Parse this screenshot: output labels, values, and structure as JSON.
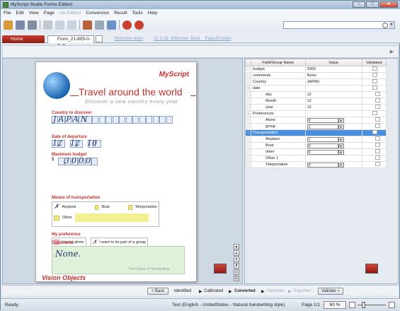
{
  "window": {
    "title": "MyScript Studio Forms Edition",
    "min_label": "–",
    "max_label": "□",
    "close_label": "✕"
  },
  "menu": [
    "File",
    "Edit",
    "View",
    "Page",
    "Ink Edition",
    "Conversion",
    "Result",
    "Tools",
    "Help"
  ],
  "menu_disabled": [
    "Ink Edition"
  ],
  "tabs": {
    "home": "Home",
    "form": "Form_21-805-0-7_0",
    "links": [
      "Welcome.notes",
      "22-2-18_Welcome_Book__Page20.notes"
    ]
  },
  "toolbar_icons": [
    "open-icon",
    "save-icon",
    "print-icon",
    "cut-icon",
    "copy-icon",
    "paste-icon",
    "ink-icon",
    "erase-icon",
    "convert-icon",
    "settings-icon",
    "help-icon"
  ],
  "form": {
    "brand": "MyScript",
    "title": "Travel around the world",
    "subtitle": "Discover a new country every year",
    "country_label": "Country to discover",
    "country_value": "JAPAN",
    "date_label": "Date of departure",
    "date_parts": [
      "12",
      "12",
      "10"
    ],
    "budget_label": "Maximum budget",
    "budget_currency": "$",
    "budget_value": "3000",
    "transport_label": "Means of transportation",
    "transport_options": [
      "Airplane",
      "Boat",
      "Teleportation"
    ],
    "transport_other": "Other",
    "pref_label": "My preference",
    "pref_options": [
      "I travel alone",
      "I want to be part of a group"
    ],
    "comments_label": "Comments",
    "comments_value": "None.",
    "footer_brand": "Vision Objects",
    "footer_tagline": "The Future of Handwriting"
  },
  "table": {
    "headers": [
      "Field/Group Name",
      "Value",
      "Validated"
    ],
    "rows": [
      {
        "name": "budget",
        "value": "3000",
        "indent": 0
      },
      {
        "name": "comments",
        "value": "None.",
        "indent": 0
      },
      {
        "name": "Country",
        "value": "JAPAN",
        "indent": 0
      },
      {
        "name": "date",
        "value": "",
        "indent": 0,
        "group": true
      },
      {
        "name": "day",
        "value": "12",
        "indent": 1
      },
      {
        "name": "Month",
        "value": "12",
        "indent": 1
      },
      {
        "name": "year",
        "value": "10",
        "indent": 1
      },
      {
        "name": "Preferences",
        "value": "",
        "indent": 0,
        "group": true
      },
      {
        "name": "Alone",
        "value": "0",
        "indent": 1,
        "input": true
      },
      {
        "name": "group",
        "value": "1",
        "indent": 1,
        "input": true
      },
      {
        "name": "Transportation",
        "value": "",
        "indent": 0,
        "group": true,
        "selected": true
      },
      {
        "name": "Airplane",
        "value": "1",
        "indent": 1,
        "input": true
      },
      {
        "name": "Boat",
        "value": "0",
        "indent": 1,
        "input": true
      },
      {
        "name": "other",
        "value": "0",
        "indent": 1,
        "input": true
      },
      {
        "name": "Other 1",
        "value": "",
        "indent": 1
      },
      {
        "name": "Teleportation",
        "value": "0",
        "indent": 1,
        "input": true
      }
    ]
  },
  "workflow": {
    "back": "< Back",
    "steps": [
      "Identified",
      "Calibrated",
      "Converted",
      "Validated",
      "Exported"
    ],
    "current": "Converted",
    "validate": "Validate >"
  },
  "status": {
    "ready": "Ready.",
    "language": "Text (English - UnitedStates - Natural handwriting style)",
    "page": "Page 1/1",
    "zoom": "60 %"
  },
  "colors": {
    "accent": "#c4302b",
    "selection": "#4a8fde",
    "chrome": "#dfe7ef"
  }
}
